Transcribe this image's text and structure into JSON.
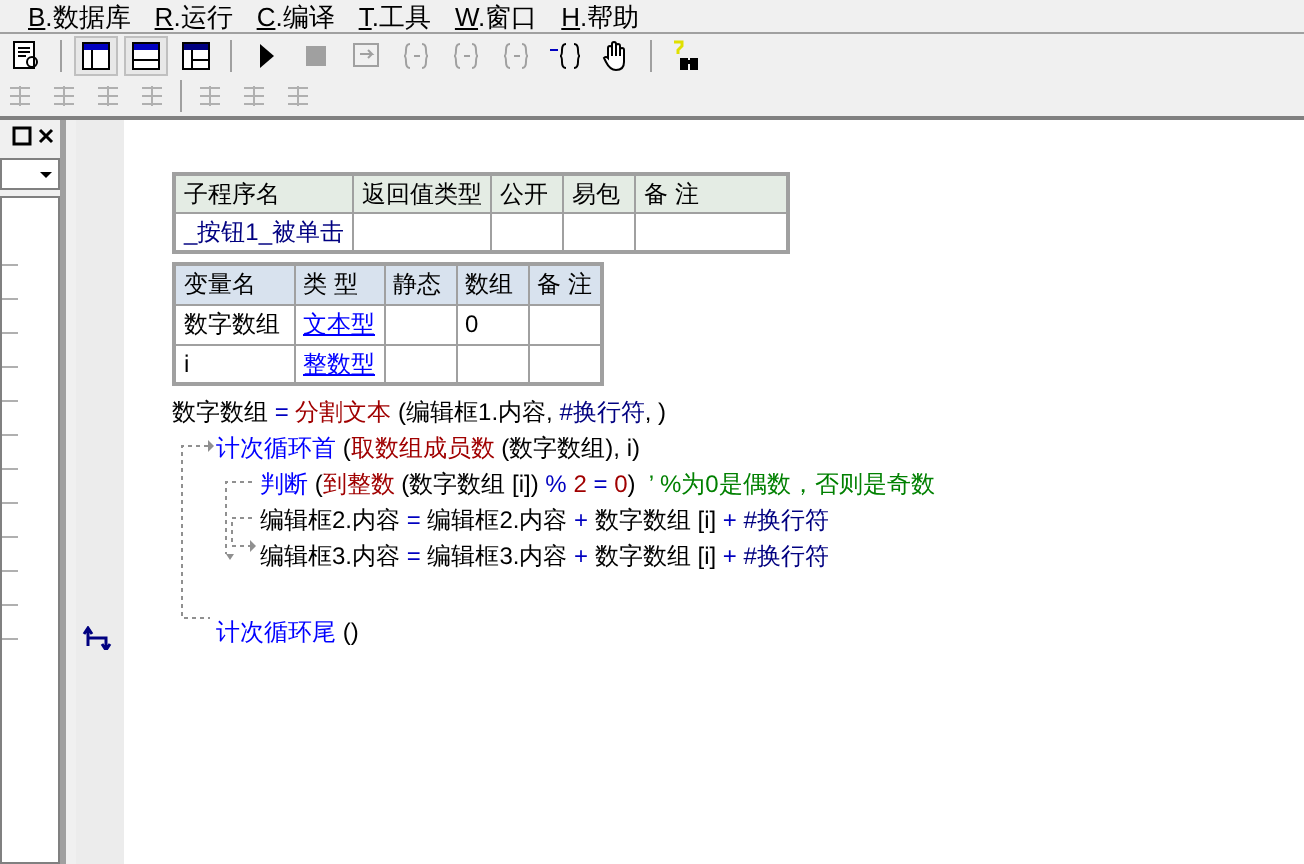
{
  "menu": [
    {
      "label": "B.数据库"
    },
    {
      "label": "R.运行"
    },
    {
      "label": "C.编译"
    },
    {
      "label": "T.工具"
    },
    {
      "label": "W.窗口"
    },
    {
      "label": "H.帮助"
    }
  ],
  "toolbar": [
    {
      "kind": "preview",
      "disabled": false,
      "selected": false
    },
    {
      "kind": "sep"
    },
    {
      "kind": "layout1",
      "disabled": false,
      "selected": true
    },
    {
      "kind": "layout2",
      "disabled": false,
      "selected": true
    },
    {
      "kind": "layout3",
      "disabled": false,
      "selected": false
    },
    {
      "kind": "sep"
    },
    {
      "kind": "run",
      "disabled": false,
      "selected": false
    },
    {
      "kind": "stop",
      "disabled": true,
      "selected": false
    },
    {
      "kind": "step",
      "disabled": true,
      "selected": false
    },
    {
      "kind": "brace",
      "disabled": true,
      "selected": false
    },
    {
      "kind": "brace",
      "disabled": true,
      "selected": false
    },
    {
      "kind": "brace",
      "disabled": true,
      "selected": false
    },
    {
      "kind": "arrowbrace",
      "disabled": false,
      "selected": false
    },
    {
      "kind": "hand",
      "disabled": false,
      "selected": false
    },
    {
      "kind": "sep"
    },
    {
      "kind": "find",
      "disabled": false,
      "selected": false
    }
  ],
  "sub_table": {
    "columns": [
      "子程序名",
      "返回值类型",
      "公开",
      "易包",
      "备 注"
    ],
    "row": {
      "name": "_按钮1_被单击"
    }
  },
  "var_table": {
    "columns": [
      "变量名",
      "类 型",
      "静态",
      "数组",
      "备 注"
    ],
    "rows": [
      {
        "name": "数字数组",
        "type": "文本型",
        "array": "0"
      },
      {
        "name": "i",
        "type": "整数型"
      }
    ]
  },
  "code": [
    {
      "tokens": [
        {
          "kind": "plain",
          "text": "数字数组"
        },
        {
          "kind": "op",
          "text": " = "
        },
        {
          "kind": "func",
          "text": "分割文本"
        },
        {
          "kind": "plain",
          "text": " (编辑框1.内容, "
        },
        {
          "kind": "const",
          "text": "#换行符"
        },
        {
          "kind": "plain",
          "text": ", )"
        }
      ]
    },
    {
      "children": [
        {
          "tokens": [
            {
              "kind": "keyword",
              "text": "计次循环首"
            },
            {
              "kind": "plain",
              "text": " ("
            },
            {
              "kind": "func",
              "text": "取数组成员数"
            },
            {
              "kind": "plain",
              "text": " (数字数组), i)"
            }
          ],
          "children": [
            {
              "tokens": [
                {
                  "kind": "keyword",
                  "text": "判断"
                },
                {
                  "kind": "plain",
                  "text": " ("
                },
                {
                  "kind": "func",
                  "text": "到整数"
                },
                {
                  "kind": "plain",
                  "text": " (数字数组 [i])"
                },
                {
                  "kind": "op",
                  "text": " % "
                },
                {
                  "kind": "num",
                  "text": "2"
                },
                {
                  "kind": "op",
                  "text": " = "
                },
                {
                  "kind": "num",
                  "text": "0"
                },
                {
                  "kind": "plain",
                  "text": ")"
                },
                {
                  "kind": "comment",
                  "text": "  ’ %为0是偶数，否则是奇数"
                }
              ]
            },
            {
              "tokens": [
                {
                  "kind": "plain",
                  "text": "编辑框2.内容"
                },
                {
                  "kind": "op",
                  "text": " = "
                },
                {
                  "kind": "plain",
                  "text": "编辑框2.内容"
                },
                {
                  "kind": "op",
                  "text": " + "
                },
                {
                  "kind": "plain",
                  "text": "数字数组 [i]"
                },
                {
                  "kind": "op",
                  "text": " + "
                },
                {
                  "kind": "const",
                  "text": "#换行符"
                }
              ]
            },
            {
              "tokens": [
                {
                  "kind": "plain",
                  "text": "编辑框3.内容"
                },
                {
                  "kind": "op",
                  "text": " = "
                },
                {
                  "kind": "plain",
                  "text": "编辑框3.内容"
                },
                {
                  "kind": "op",
                  "text": " + "
                },
                {
                  "kind": "plain",
                  "text": "数字数组 [i]"
                },
                {
                  "kind": "op",
                  "text": " + "
                },
                {
                  "kind": "const",
                  "text": "#换行符"
                }
              ]
            }
          ]
        },
        {
          "tokens": [
            {
              "kind": "keyword",
              "text": "计次循环尾"
            },
            {
              "kind": "plain",
              "text": " ()"
            }
          ]
        }
      ]
    }
  ]
}
